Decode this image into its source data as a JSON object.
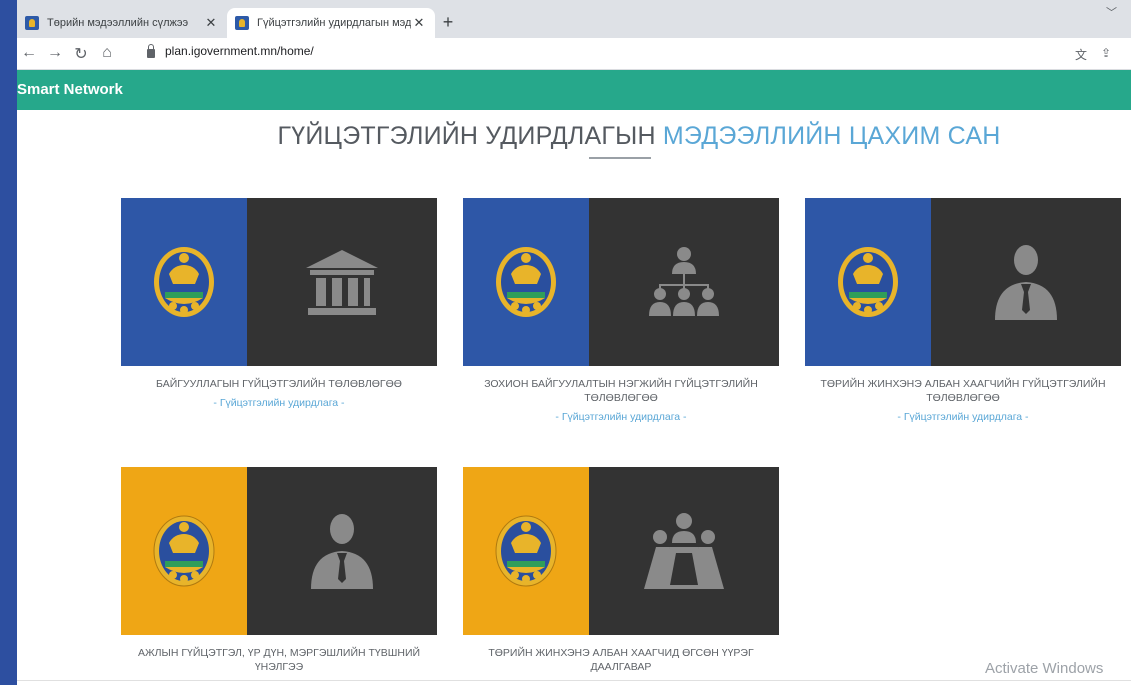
{
  "browser": {
    "tabs": [
      {
        "title": "Төрийн мэдээллийн сүлжээ",
        "active": false
      },
      {
        "title": "Гүйцэтгэлийн удирдлагын мэдэ",
        "active": true
      }
    ],
    "url": "plan.igovernment.mn/home/"
  },
  "nav": {
    "brand": "Smart Network"
  },
  "page": {
    "title_main": "ГҮЙЦЭТГЭЛИЙН УДИРДЛАГЫН",
    "title_accent": "МЭДЭЭЛЛИЙН ЦАХИМ САН"
  },
  "cards": [
    {
      "title": "БАЙГУУЛЛАГЫН ГҮЙЦЭТГЭЛИЙН ТӨЛӨВЛӨГӨӨ",
      "link": "- Гүйцэтгэлийн удирдлага -",
      "strip_color": "#2e57a7",
      "icon": "building-icon"
    },
    {
      "title": "ЗОХИОН БАЙГУУЛАЛТЫН НЭГЖИЙН ГҮЙЦЭТГЭЛИЙН ТӨЛӨВЛӨГӨӨ",
      "link": "- Гүйцэтгэлийн удирдлага -",
      "strip_color": "#2e57a7",
      "icon": "org-chart-icon"
    },
    {
      "title": "ТӨРИЙН ЖИНХЭНЭ АЛБАН ХААГЧИЙН ГҮЙЦЭТГЭЛИЙН ТӨЛӨВЛӨГӨӨ",
      "link": "- Гүйцэтгэлийн удирдлага -",
      "strip_color": "#2e57a7",
      "icon": "person-icon"
    },
    {
      "title": "АЖЛЫН ГҮЙЦЭТГЭЛ, ҮР ДҮН, МЭРГЭШЛИЙН ТҮВШНИЙ ҮНЭЛГЭЭ",
      "link": "",
      "strip_color": "#efa615",
      "icon": "person-icon"
    },
    {
      "title": "ТӨРИЙН ЖИНХЭНЭ АЛБАН ХААГЧИД ӨГСӨН ҮҮРЭГ ДААЛГАВАР",
      "link": "",
      "strip_color": "#efa615",
      "icon": "meeting-icon"
    }
  ],
  "watermark": "Activate Windows"
}
